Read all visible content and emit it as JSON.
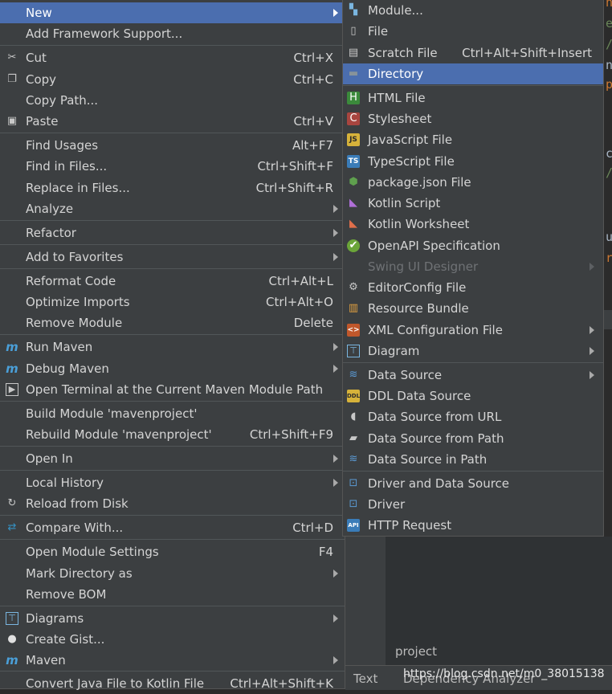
{
  "left_menu": {
    "items": [
      {
        "label": "New",
        "shortcut": "",
        "submenu": true,
        "selected": true,
        "icon": ""
      },
      {
        "label": "Add Framework Support...",
        "shortcut": "",
        "submenu": false,
        "icon": ""
      },
      {
        "label": "Cut",
        "shortcut": "Ctrl+X",
        "submenu": false,
        "icon": "scissors-icon"
      },
      {
        "label": "Copy",
        "shortcut": "Ctrl+C",
        "submenu": false,
        "icon": "copy-icon"
      },
      {
        "label": "Copy Path...",
        "shortcut": "",
        "submenu": false,
        "icon": ""
      },
      {
        "label": "Paste",
        "shortcut": "Ctrl+V",
        "submenu": false,
        "icon": "clipboard-icon"
      },
      {
        "label": "Find Usages",
        "shortcut": "Alt+F7",
        "submenu": false,
        "icon": ""
      },
      {
        "label": "Find in Files...",
        "shortcut": "Ctrl+Shift+F",
        "submenu": false,
        "icon": ""
      },
      {
        "label": "Replace in Files...",
        "shortcut": "Ctrl+Shift+R",
        "submenu": false,
        "icon": ""
      },
      {
        "label": "Analyze",
        "shortcut": "",
        "submenu": true,
        "icon": ""
      },
      {
        "label": "Refactor",
        "shortcut": "",
        "submenu": true,
        "icon": ""
      },
      {
        "label": "Add to Favorites",
        "shortcut": "",
        "submenu": true,
        "icon": ""
      },
      {
        "label": "Reformat Code",
        "shortcut": "Ctrl+Alt+L",
        "submenu": false,
        "icon": ""
      },
      {
        "label": "Optimize Imports",
        "shortcut": "Ctrl+Alt+O",
        "submenu": false,
        "icon": ""
      },
      {
        "label": "Remove Module",
        "shortcut": "Delete",
        "submenu": false,
        "icon": ""
      },
      {
        "label": "Run Maven",
        "shortcut": "",
        "submenu": true,
        "icon": "maven-run-icon"
      },
      {
        "label": "Debug Maven",
        "shortcut": "",
        "submenu": true,
        "icon": "maven-debug-icon"
      },
      {
        "label": "Open Terminal at the Current Maven Module Path",
        "shortcut": "",
        "submenu": false,
        "icon": "terminal-icon"
      },
      {
        "label": "Build Module 'mavenproject'",
        "shortcut": "",
        "submenu": false,
        "icon": ""
      },
      {
        "label": "Rebuild Module 'mavenproject'",
        "shortcut": "Ctrl+Shift+F9",
        "submenu": false,
        "icon": ""
      },
      {
        "label": "Open In",
        "shortcut": "",
        "submenu": true,
        "icon": ""
      },
      {
        "label": "Local History",
        "shortcut": "",
        "submenu": true,
        "icon": ""
      },
      {
        "label": "Reload from Disk",
        "shortcut": "",
        "submenu": false,
        "icon": "reload-icon"
      },
      {
        "label": "Compare With...",
        "shortcut": "Ctrl+D",
        "submenu": false,
        "icon": "compare-icon"
      },
      {
        "label": "Open Module Settings",
        "shortcut": "F4",
        "submenu": false,
        "icon": ""
      },
      {
        "label": "Mark Directory as",
        "shortcut": "",
        "submenu": true,
        "icon": ""
      },
      {
        "label": "Remove BOM",
        "shortcut": "",
        "submenu": false,
        "icon": ""
      },
      {
        "label": "Diagrams",
        "shortcut": "",
        "submenu": true,
        "icon": "diagram-icon"
      },
      {
        "label": "Create Gist...",
        "shortcut": "",
        "submenu": false,
        "icon": "github-icon"
      },
      {
        "label": "Maven",
        "shortcut": "",
        "submenu": true,
        "icon": "maven-icon"
      },
      {
        "label": "Convert Java File to Kotlin File",
        "shortcut": "Ctrl+Alt+Shift+K",
        "submenu": false,
        "icon": ""
      }
    ]
  },
  "right_menu": {
    "items": [
      {
        "label": "Module...",
        "shortcut": "",
        "submenu": false,
        "icon": "module-icon"
      },
      {
        "label": "File",
        "shortcut": "",
        "submenu": false,
        "icon": "file-icon"
      },
      {
        "label": "Scratch File",
        "shortcut": "Ctrl+Alt+Shift+Insert",
        "submenu": false,
        "icon": "scratch-file-icon"
      },
      {
        "label": "Directory",
        "shortcut": "",
        "submenu": false,
        "selected": true,
        "icon": "folder-icon"
      },
      {
        "label": "HTML File",
        "shortcut": "",
        "submenu": false,
        "icon": "html-file-icon"
      },
      {
        "label": "Stylesheet",
        "shortcut": "",
        "submenu": false,
        "icon": "css-file-icon"
      },
      {
        "label": "JavaScript File",
        "shortcut": "",
        "submenu": false,
        "icon": "js-file-icon"
      },
      {
        "label": "TypeScript File",
        "shortcut": "",
        "submenu": false,
        "icon": "ts-file-icon"
      },
      {
        "label": "package.json File",
        "shortcut": "",
        "submenu": false,
        "icon": "nodejs-icon"
      },
      {
        "label": "Kotlin Script",
        "shortcut": "",
        "submenu": false,
        "icon": "kotlin-script-icon"
      },
      {
        "label": "Kotlin Worksheet",
        "shortcut": "",
        "submenu": false,
        "icon": "kotlin-worksheet-icon"
      },
      {
        "label": "OpenAPI Specification",
        "shortcut": "",
        "submenu": false,
        "icon": "openapi-icon"
      },
      {
        "label": "Swing UI Designer",
        "shortcut": "",
        "submenu": true,
        "disabled": true,
        "icon": ""
      },
      {
        "label": "EditorConfig File",
        "shortcut": "",
        "submenu": false,
        "icon": "gear-icon"
      },
      {
        "label": "Resource Bundle",
        "shortcut": "",
        "submenu": false,
        "icon": "resource-bundle-icon"
      },
      {
        "label": "XML Configuration File",
        "shortcut": "",
        "submenu": true,
        "icon": "xml-file-icon"
      },
      {
        "label": "Diagram",
        "shortcut": "",
        "submenu": true,
        "icon": "diagram-icon"
      },
      {
        "label": "Data Source",
        "shortcut": "",
        "submenu": true,
        "icon": "database-icon"
      },
      {
        "label": "DDL Data Source",
        "shortcut": "",
        "submenu": false,
        "icon": "ddl-icon"
      },
      {
        "label": "Data Source from URL",
        "shortcut": "",
        "submenu": false,
        "icon": "plug-icon"
      },
      {
        "label": "Data Source from Path",
        "shortcut": "",
        "submenu": false,
        "icon": "open-folder-icon"
      },
      {
        "label": "Data Source in Path",
        "shortcut": "",
        "submenu": false,
        "icon": "database-icon"
      },
      {
        "label": "Driver and Data Source",
        "shortcut": "",
        "submenu": false,
        "icon": "driver-icon"
      },
      {
        "label": "Driver",
        "shortcut": "",
        "submenu": false,
        "icon": "driver-icon"
      },
      {
        "label": "HTTP Request",
        "shortcut": "",
        "submenu": false,
        "icon": "api-icon"
      }
    ]
  },
  "background": {
    "project_label": "project",
    "text_tab": "Text",
    "dependency_tab": "Dependency Analyzer",
    "watermark": "https://blog.csdn.net/m0_38015138"
  },
  "colors": {
    "menu_bg": "#3c3f41",
    "selection": "#4b6eaf",
    "text": "#d4d4d4",
    "disabled_text": "#6f7275"
  }
}
